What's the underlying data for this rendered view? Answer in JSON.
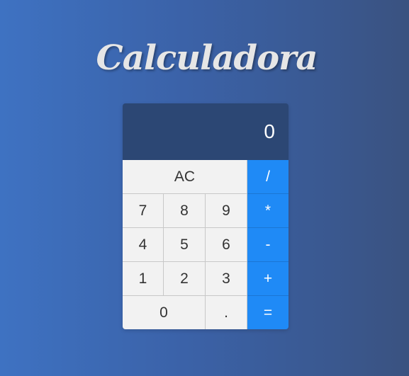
{
  "title": "Calculadora",
  "display": "0",
  "keys": {
    "clear": "AC",
    "divide": "/",
    "seven": "7",
    "eight": "8",
    "nine": "9",
    "multiply": "*",
    "four": "4",
    "five": "5",
    "six": "6",
    "subtract": "-",
    "one": "1",
    "two": "2",
    "three": "3",
    "add": "+",
    "zero": "0",
    "decimal": ".",
    "equals": "="
  },
  "colors": {
    "display_bg": "#2c4774",
    "operator_bg": "#1f8af6",
    "key_bg": "#f2f2f2"
  }
}
